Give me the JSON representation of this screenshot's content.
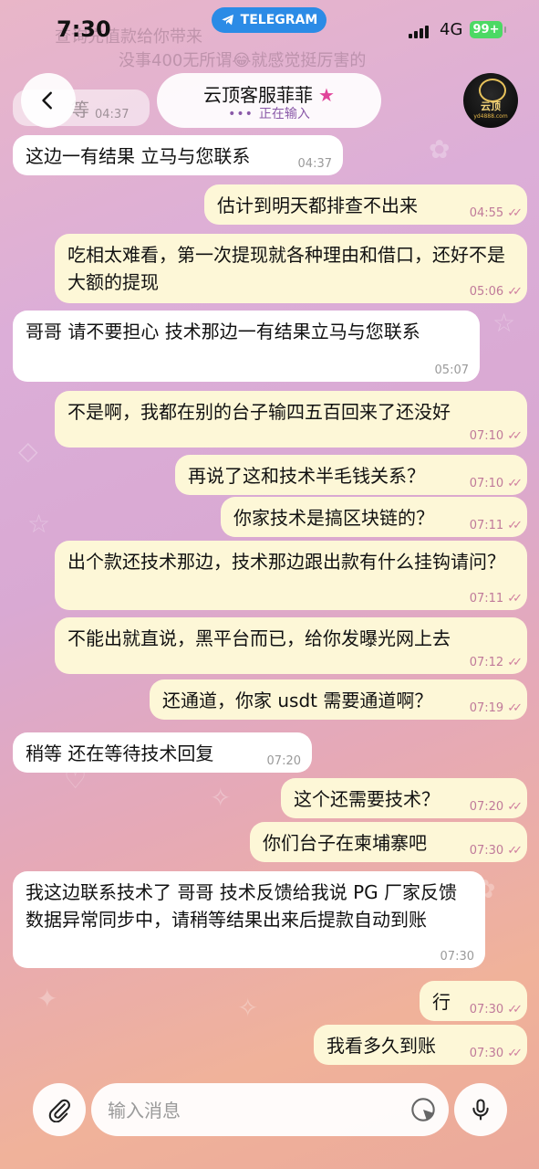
{
  "status_bar": {
    "time": "7:30",
    "app_pill": "TELEGRAM",
    "network": "4G",
    "battery": "99+",
    "faded_line_1": "查询充值款给你带来",
    "faded_line_2": "没事400无所谓😂就感觉挺厉害的"
  },
  "header": {
    "title": "云顶客服菲菲",
    "star": "★",
    "status": "正在输入",
    "avatar_name": "云顶",
    "avatar_sub": "yd4888.com"
  },
  "partial_message": {
    "text": "等",
    "time": "04:37"
  },
  "messages": [
    {
      "dir": "in",
      "text": "这边一有结果 立马与您联系",
      "time": "04:37"
    },
    {
      "dir": "out",
      "text": "估计到明天都排查不出来",
      "time": "04:55"
    },
    {
      "dir": "out",
      "text": "吃相太难看，第一次提现就各种理由和借口，还好不是大额的提现",
      "time": "05:06"
    },
    {
      "dir": "in",
      "text": "哥哥 请不要担心  技术那边一有结果立马与您联系",
      "time": "05:07"
    },
    {
      "dir": "out",
      "text": "不是啊，我都在别的台子输四五百回来了还没好",
      "time": "07:10"
    },
    {
      "dir": "out",
      "text": "再说了这和技术半毛钱关系？",
      "time": "07:10"
    },
    {
      "dir": "out",
      "text": "你家技术是搞区块链的？",
      "time": "07:11"
    },
    {
      "dir": "out",
      "text": "出个款还技术那边，技术那边跟出款有什么挂钩请问？",
      "time": "07:11"
    },
    {
      "dir": "out",
      "text": "不能出就直说，黑平台而已，给你发曝光网上去",
      "time": "07:12"
    },
    {
      "dir": "out",
      "text": "还通道，你家 usdt 需要通道啊？",
      "time": "07:19"
    },
    {
      "dir": "in",
      "text": "稍等   还在等待技术回复",
      "time": "07:20"
    },
    {
      "dir": "out",
      "text": "这个还需要技术？",
      "time": "07:20"
    },
    {
      "dir": "out",
      "text": "你们台子在柬埔寨吧",
      "time": "07:30"
    },
    {
      "dir": "in",
      "text": "我这边联系技术了 哥哥  技术反馈给我说 PG 厂家反馈数据异常同步中，请稍等结果出来后提款自动到账",
      "time": "07:30"
    },
    {
      "dir": "out",
      "text": "行",
      "time": "07:30"
    },
    {
      "dir": "out",
      "text": "我看多久到账",
      "time": "07:30"
    }
  ],
  "composer": {
    "placeholder": "输入消息"
  },
  "colors": {
    "incoming_bubble": "#ffffff",
    "outgoing_bubble": "#fdf7d7",
    "telegram_blue": "#2b8be6",
    "star_pink": "#e0449a"
  },
  "icons": [
    "back-arrow-icon",
    "telegram-icon",
    "star-icon",
    "attach-icon",
    "sticker-icon",
    "mic-icon"
  ]
}
